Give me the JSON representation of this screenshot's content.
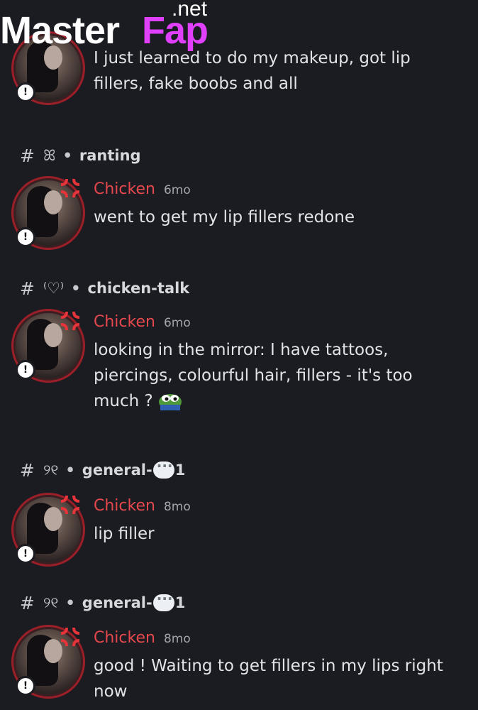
{
  "watermark": {
    "master": "Master",
    "fap": "Fap",
    "net": ".net"
  },
  "messages": [
    {
      "channel": {
        "prefix": "",
        "name": ""
      },
      "user": "",
      "time": "",
      "text": "I just learned to do my makeup, got lip fillers, fake boobs and all"
    },
    {
      "channel": {
        "prefix": "ꕤ",
        "name": "ranting"
      },
      "user": "Chicken",
      "time": "6mo",
      "text": "went to get my lip fillers redone"
    },
    {
      "channel": {
        "prefix": "⁽♡⁾",
        "name": "chicken-talk"
      },
      "user": "Chicken",
      "time": "6mo",
      "text": "looking in the mirror: I have tattoos, piercings, colourful hair, fillers - it's too much ?"
    },
    {
      "channel": {
        "prefix": "୨୧",
        "name": "general-",
        "suffix": "1"
      },
      "user": "Chicken",
      "time": "8mo",
      "text": "lip filler"
    },
    {
      "channel": {
        "prefix": "୨୧",
        "name": "general-",
        "suffix": "1"
      },
      "user": "Chicken",
      "time": "8mo",
      "text": "good ! Waiting to get fillers in my lips right now"
    }
  ],
  "badge_symbol": "!",
  "colors": {
    "background": "#1b1c21",
    "username": "#e5484d",
    "avatar_ring": "#9b1f28"
  },
  "icons": [
    "hash-icon",
    "speech-bubble-icon",
    "anger-symbol-icon",
    "alert-badge-icon",
    "pepe-emoji-icon"
  ]
}
